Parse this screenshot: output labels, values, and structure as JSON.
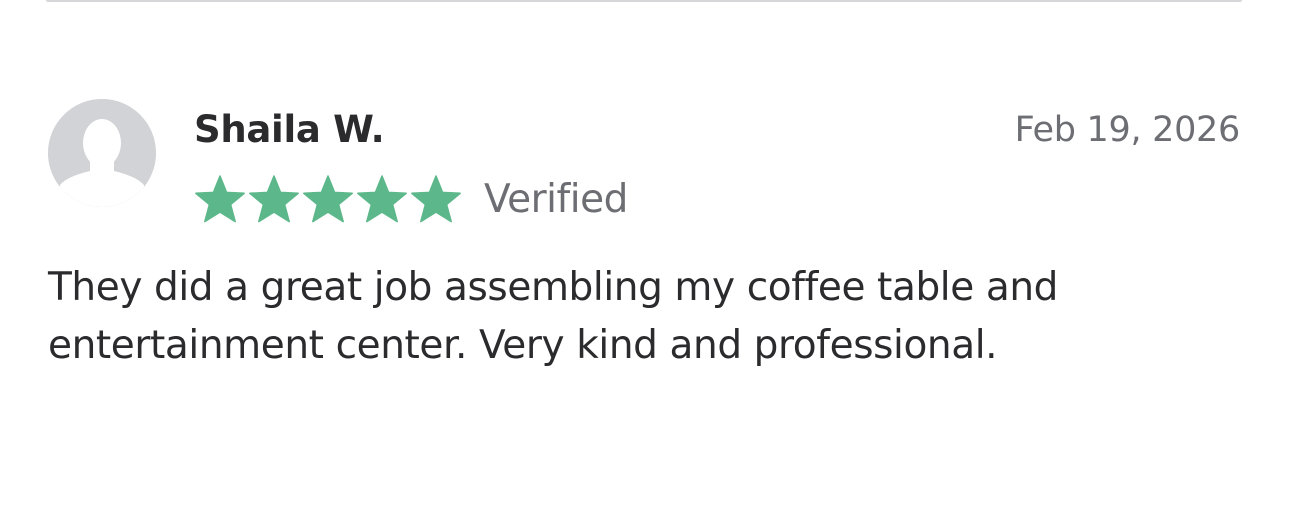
{
  "review": {
    "reviewer_name": "Shaila W.",
    "date": "Feb 19, 2026",
    "rating": 5,
    "rating_max": 5,
    "verified_label": "Verified",
    "text": "They did a great job assembling my coffee table and entertainment center. Very kind and professional.",
    "avatar_icon": "user-silhouette-icon",
    "star_icon": "star-icon"
  },
  "colors": {
    "star": "#5cb88a",
    "avatar_bg": "#d2d3d6",
    "avatar_silhouette": "#ffffff",
    "name_text": "#2b2b2e",
    "muted_text": "#6d6e73",
    "divider": "#d6d6d8"
  }
}
